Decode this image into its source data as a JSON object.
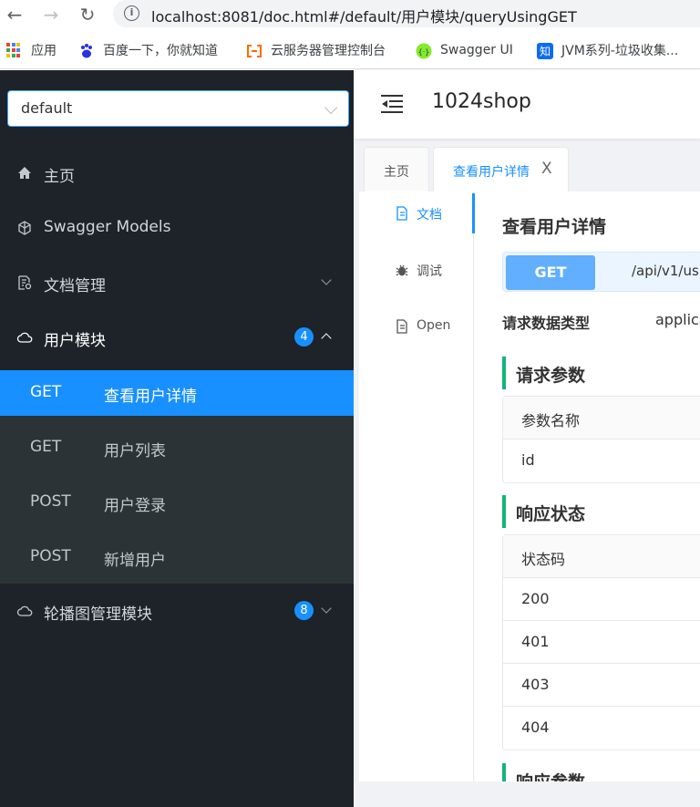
{
  "browser": {
    "url": "localhost:8081/doc.html#/default/用户模块/queryUsingGET",
    "bookmarks": [
      {
        "label": "应用",
        "icon": "apps-grid-icon"
      },
      {
        "label": "百度一下，你就知道",
        "icon": "baidu-paw-icon"
      },
      {
        "label": "云服务器管理控制台",
        "icon": "aliyun-icon"
      },
      {
        "label": "Swagger UI",
        "icon": "swagger-icon"
      },
      {
        "label": "JVM系列-垃圾收集...",
        "icon": "zhihu-icon"
      }
    ]
  },
  "sidebar": {
    "group_select": "default",
    "menu": {
      "home": "主页",
      "models": "Swagger Models",
      "docs": "文档管理",
      "user_module": "用户模块",
      "user_module_count": "4",
      "banner_module": "轮播图管理模块",
      "banner_module_count": "8"
    },
    "apis": [
      {
        "method": "GET",
        "name": "查看用户详情"
      },
      {
        "method": "GET",
        "name": "用户列表"
      },
      {
        "method": "POST",
        "name": "用户登录"
      },
      {
        "method": "POST",
        "name": "新增用户"
      }
    ]
  },
  "header": {
    "title": "1024shop"
  },
  "tabs": [
    {
      "label": "主页"
    },
    {
      "label": "查看用户详情",
      "close": "X"
    }
  ],
  "vtabs": [
    {
      "label": "文档"
    },
    {
      "label": "调试"
    },
    {
      "label": "Open"
    }
  ],
  "doc": {
    "title": "查看用户详情",
    "method": "GET",
    "path": "/api/v1/us",
    "req_type_label": "请求数据类型",
    "req_type_value": "applica",
    "params_title": "请求参数",
    "params_header": "参数名称",
    "params_rows": [
      "id"
    ],
    "status_title": "响应状态",
    "status_header": "状态码",
    "status_rows": [
      "200",
      "401",
      "403",
      "404"
    ],
    "resp_title": "响应参数"
  },
  "colors": {
    "sidebar_bg": "#1d2329",
    "submenu_bg": "#2b3337",
    "active_blue": "#1890ff",
    "get_badge": "#61affe",
    "section_bar": "#11b57a"
  }
}
